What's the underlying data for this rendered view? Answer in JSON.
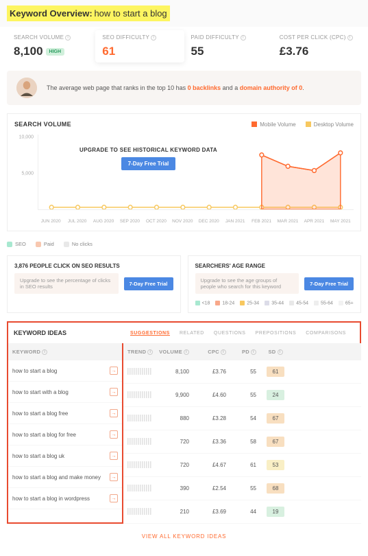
{
  "header": {
    "title_label": "Keyword Overview:",
    "query": "how to start a blog"
  },
  "stats": {
    "search_volume_label": "SEARCH VOLUME",
    "search_volume_value": "8,100",
    "search_volume_badge": "HIGH",
    "seo_diff_label": "SEO DIFFICULTY",
    "seo_diff_value": "61",
    "paid_diff_label": "PAID DIFFICULTY",
    "paid_diff_value": "55",
    "cpc_label": "COST PER CLICK (CPC)",
    "cpc_value": "£3.76"
  },
  "insight": {
    "prefix": "The average web page that ranks in the top 10 has ",
    "backlinks": "0 backlinks",
    "mid": " and a ",
    "da": "domain authority of 0",
    "suffix": "."
  },
  "chart": {
    "title": "SEARCH VOLUME",
    "legend_mobile": "Mobile Volume",
    "legend_desktop": "Desktop Volume",
    "upgrade_text": "UPGRADE TO SEE HISTORICAL KEYWORD DATA",
    "trial_button": "7-Day Free Trial",
    "y_max": "10,000",
    "y_mid": "5,000"
  },
  "chart_data": {
    "type": "line",
    "xlabel": "",
    "ylabel": "",
    "ylim": [
      0,
      10000
    ],
    "categories": [
      "JUN 2020",
      "JUL 2020",
      "AUG 2020",
      "SEP 2020",
      "OCT 2020",
      "NOV 2020",
      "DEC 2020",
      "JAN 2021",
      "FEB 2021",
      "MAR 2021",
      "APR 2021",
      "MAY 2021"
    ],
    "series": [
      {
        "name": "Desktop Volume",
        "color": "#f7c85f",
        "values": [
          0,
          0,
          0,
          0,
          0,
          0,
          0,
          0,
          0,
          0,
          0,
          0
        ]
      },
      {
        "name": "Mobile Volume",
        "color": "#ff6a2f",
        "values": [
          null,
          null,
          null,
          null,
          null,
          null,
          null,
          null,
          7400,
          5800,
          5200,
          7700
        ]
      }
    ]
  },
  "seo_legend": {
    "seo": "SEO",
    "paid": "Paid",
    "noclicks": "No clicks"
  },
  "seo_clicks": {
    "title": "3,876 PEOPLE CLICK ON SEO RESULTS",
    "sub": "Upgrade to see the percentage of clicks in SEO results",
    "trial_button": "7-Day Free Trial"
  },
  "age_range": {
    "title": "SEARCHERS' AGE RANGE",
    "sub": "Upgrade to see the age groups of people who search for this keyword",
    "trial_button": "7-Day Free Trial",
    "buckets": [
      "<18",
      "18-24",
      "25-34",
      "35-44",
      "45-54",
      "55-64",
      "65+"
    ]
  },
  "ideas": {
    "title": "KEYWORD IDEAS",
    "tabs": [
      "SUGGESTIONS",
      "RELATED",
      "QUESTIONS",
      "PREPOSITIONS",
      "COMPARISONS"
    ],
    "active_tab": "SUGGESTIONS",
    "columns": {
      "keyword": "KEYWORD",
      "trend": "TREND",
      "volume": "VOLUME",
      "cpc": "CPC",
      "pd": "PD",
      "sd": "SD"
    },
    "rows": [
      {
        "keyword": "how to start a blog",
        "volume": "8,100",
        "cpc": "£3.76",
        "pd": "55",
        "sd": "61",
        "sd_class": "sd-orange"
      },
      {
        "keyword": "how to start with a blog",
        "volume": "9,900",
        "cpc": "£4.60",
        "pd": "55",
        "sd": "24",
        "sd_class": "sd-green"
      },
      {
        "keyword": "how to start a blog free",
        "volume": "880",
        "cpc": "£3.28",
        "pd": "54",
        "sd": "67",
        "sd_class": "sd-orange"
      },
      {
        "keyword": "how to start a blog for free",
        "volume": "720",
        "cpc": "£3.36",
        "pd": "58",
        "sd": "67",
        "sd_class": "sd-orange"
      },
      {
        "keyword": "how to start a blog uk",
        "volume": "720",
        "cpc": "£4.67",
        "pd": "61",
        "sd": "53",
        "sd_class": "sd-yellow"
      },
      {
        "keyword": "how to start a blog and make money",
        "volume": "390",
        "cpc": "£2.54",
        "pd": "55",
        "sd": "68",
        "sd_class": "sd-orange"
      },
      {
        "keyword": "how to start a blog in wordpress",
        "volume": "210",
        "cpc": "£3.69",
        "pd": "44",
        "sd": "19",
        "sd_class": "sd-green"
      }
    ],
    "view_all": "VIEW ALL KEYWORD IDEAS"
  }
}
